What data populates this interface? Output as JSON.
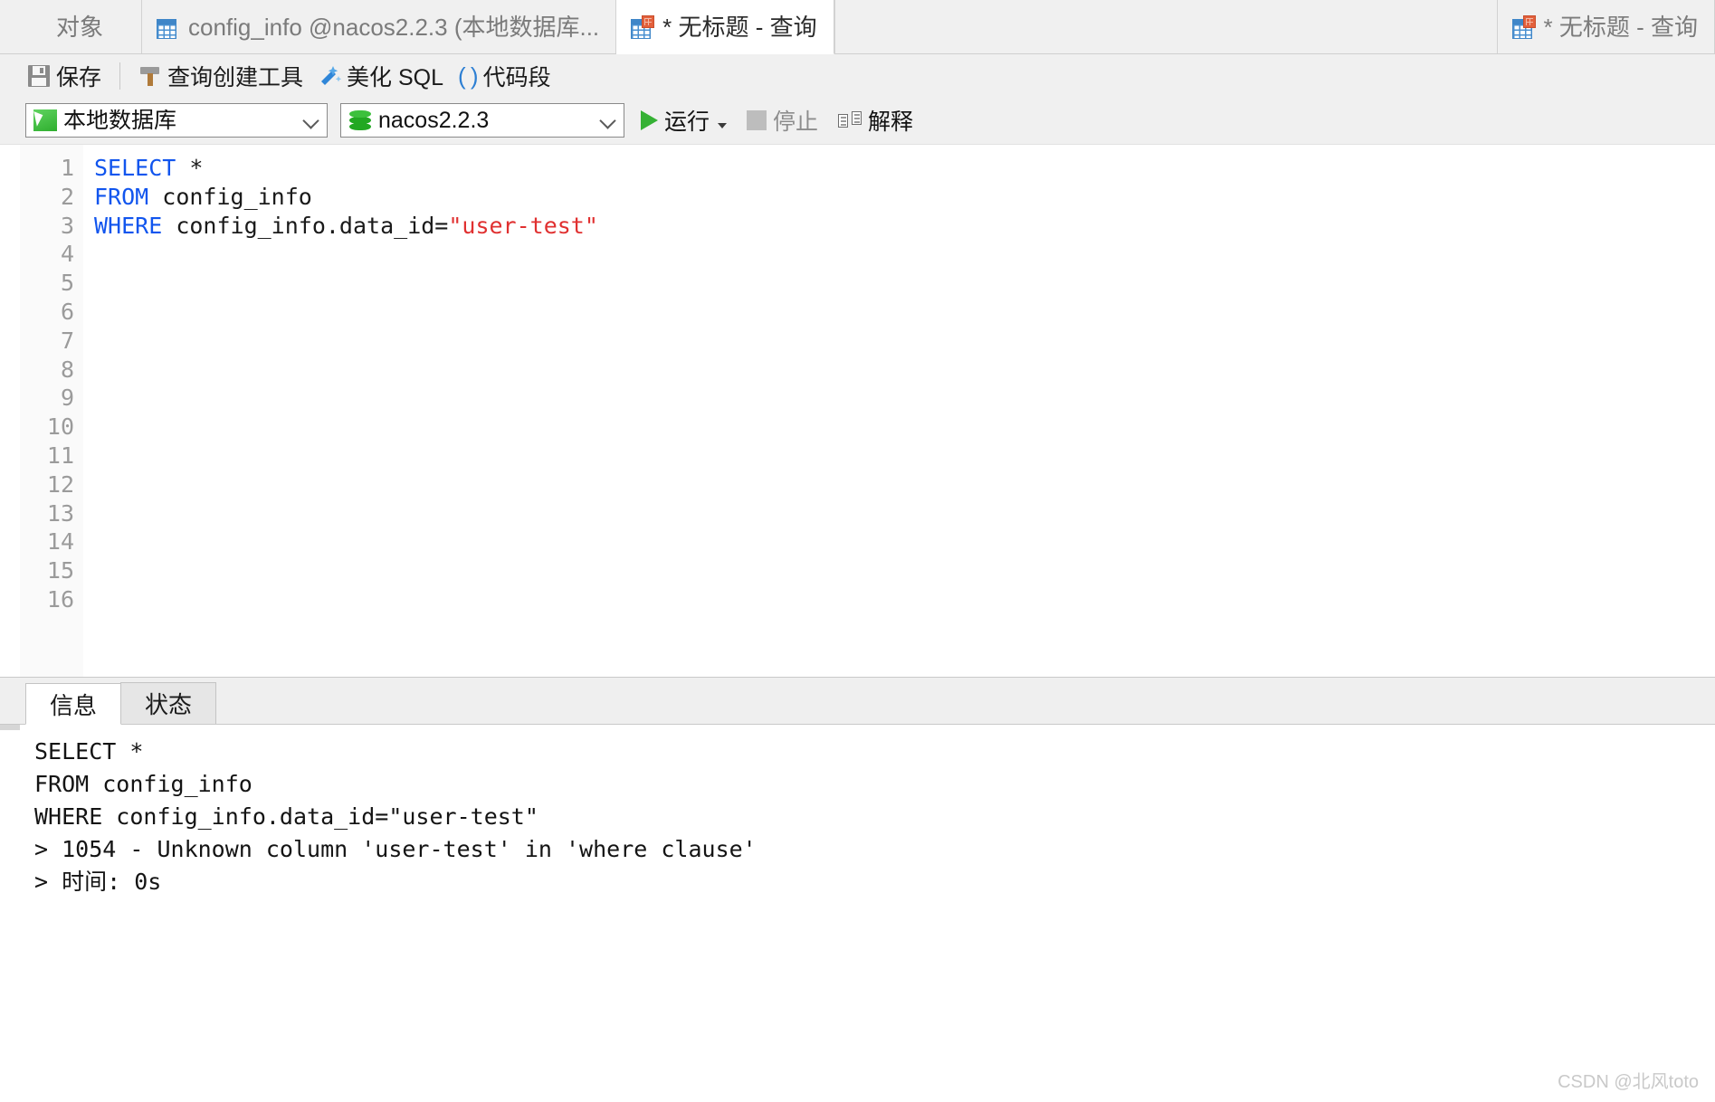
{
  "window": {
    "app": "Navicat Query Editor"
  },
  "tabs": [
    {
      "label": "对象",
      "icon": "none",
      "active": false
    },
    {
      "label": "config_info @nacos2.2.3 (本地数据库...",
      "icon": "grid-plain-icon",
      "active": false
    },
    {
      "label": "* 无标题 - 查询",
      "icon": "grid-query-icon",
      "active": true
    },
    {
      "label": "* 无标题 - 查询",
      "icon": "grid-query-icon",
      "active": false
    }
  ],
  "toolbar": {
    "save_label": "保存",
    "query_builder_label": "查询创建工具",
    "beautify_label": "美化 SQL",
    "snippet_paren": "( )",
    "snippet_label": "代码段"
  },
  "connbar": {
    "connection_value": "本地数据库",
    "database_value": "nacos2.2.3",
    "run_label": "运行",
    "run_caret": "·",
    "stop_label": "停止",
    "explain_label": "解释"
  },
  "editor": {
    "line_numbers": [
      "1",
      "2",
      "3",
      "4",
      "5",
      "6",
      "7",
      "8",
      "9",
      "10",
      "11",
      "12",
      "13",
      "14",
      "15",
      "16"
    ],
    "lines": [
      {
        "tokens": [
          {
            "t": "SELECT",
            "c": "kw"
          },
          {
            "t": " *",
            "c": ""
          }
        ]
      },
      {
        "tokens": [
          {
            "t": "FROM",
            "c": "kw"
          },
          {
            "t": " config_info",
            "c": ""
          }
        ]
      },
      {
        "tokens": [
          {
            "t": "WHERE",
            "c": "kw"
          },
          {
            "t": " config_info.data_id=",
            "c": ""
          },
          {
            "t": "\"user-test\"",
            "c": "str"
          }
        ]
      },
      {
        "tokens": []
      },
      {
        "tokens": []
      },
      {
        "tokens": []
      },
      {
        "tokens": []
      },
      {
        "tokens": []
      },
      {
        "tokens": []
      },
      {
        "tokens": []
      },
      {
        "tokens": []
      },
      {
        "tokens": []
      },
      {
        "tokens": []
      },
      {
        "tokens": []
      },
      {
        "tokens": []
      },
      {
        "tokens": []
      }
    ],
    "plain_text": "SELECT *\nFROM config_info\nWHERE config_info.data_id=\"user-test\""
  },
  "result": {
    "tabs": [
      {
        "label": "信息",
        "active": true
      },
      {
        "label": "状态",
        "active": false
      }
    ],
    "output_lines": [
      "SELECT *",
      "FROM config_info",
      "WHERE config_info.data_id=\"user-test\"",
      "> 1054 - Unknown column 'user-test' in 'where clause'",
      "> 时间: 0s"
    ]
  },
  "watermark": "CSDN @北风toto",
  "colors": {
    "keyword": "#1155ee",
    "string": "#e03030",
    "run_green": "#35b134",
    "chrome_bg": "#f0f0f0"
  }
}
